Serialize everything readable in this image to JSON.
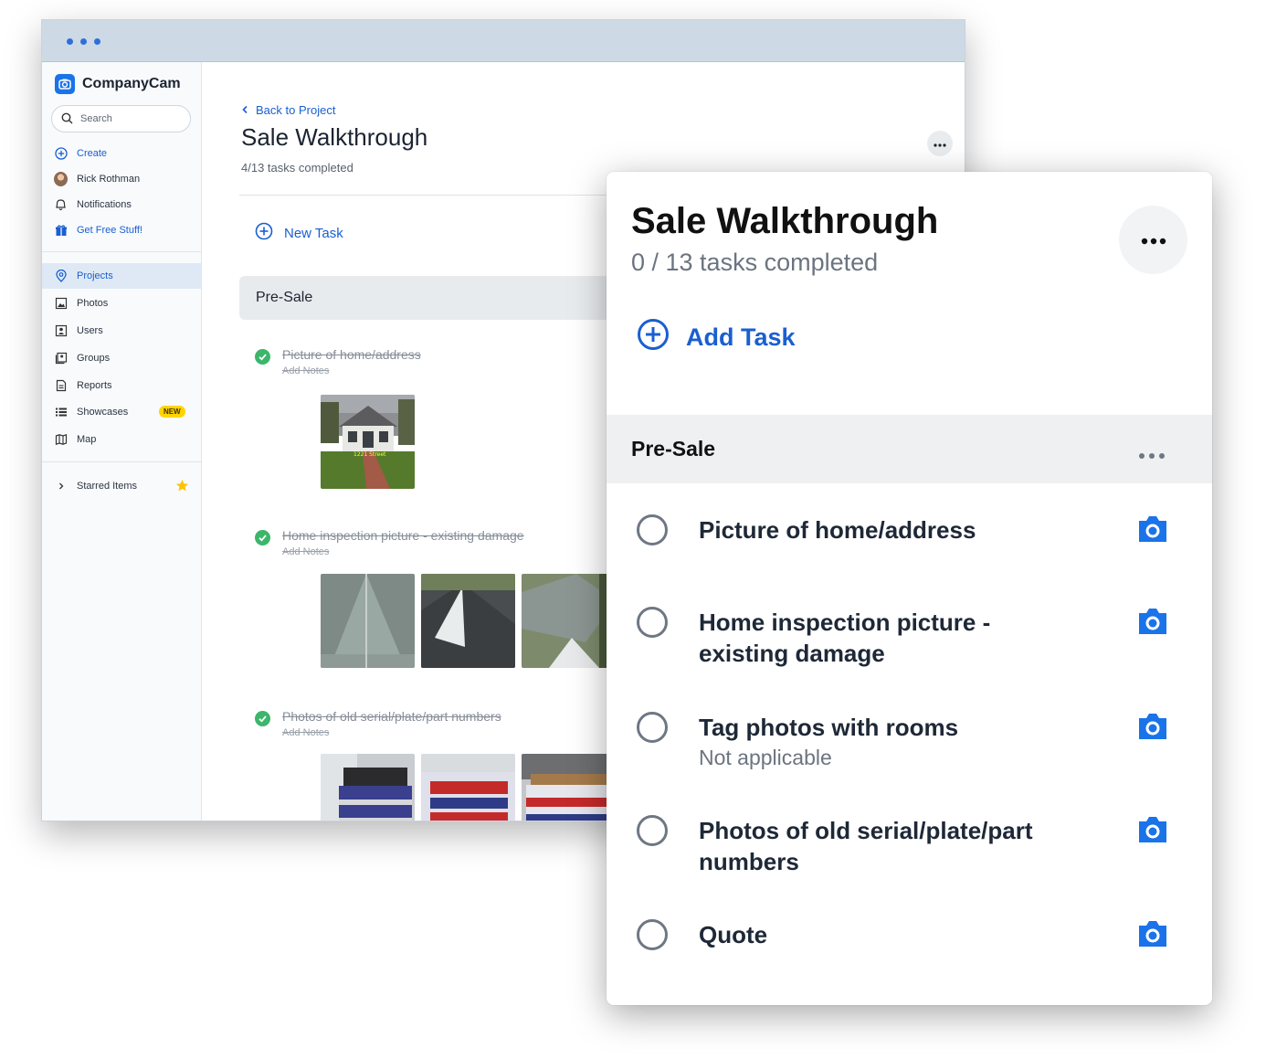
{
  "app": {
    "brand": "CompanyCam",
    "search_placeholder": "Search"
  },
  "sidebar": {
    "top_items": [
      {
        "label": "Create",
        "icon": "plus-circle-icon"
      },
      {
        "label": "Rick Rothman",
        "icon": "avatar"
      },
      {
        "label": "Notifications",
        "icon": "bell-icon"
      },
      {
        "label": "Get Free Stuff!",
        "icon": "gift-icon"
      }
    ],
    "nav_items": [
      {
        "label": "Projects",
        "icon": "location-pin-icon",
        "active": true
      },
      {
        "label": "Photos",
        "icon": "photos-icon"
      },
      {
        "label": "Users",
        "icon": "user-icon"
      },
      {
        "label": "Groups",
        "icon": "groups-icon"
      },
      {
        "label": "Reports",
        "icon": "report-icon"
      },
      {
        "label": "Showcases",
        "icon": "list-icon",
        "badge": "NEW"
      },
      {
        "label": "Map",
        "icon": "map-icon"
      }
    ],
    "starred": {
      "label": "Starred Items",
      "icon": "star-icon"
    }
  },
  "desktop": {
    "back_label": "Back to Project",
    "title": "Sale Walkthrough",
    "tasks_completed": "4/13 tasks completed",
    "new_task_label": "New Task",
    "section_title": "Pre-Sale",
    "tasks": [
      {
        "name": "Picture of home/address",
        "notes": "Add Notes",
        "photo_count": 1
      },
      {
        "name": "Home inspection picture - existing damage",
        "notes": "Add Notes",
        "photo_count": 4
      },
      {
        "name": "Photos of old serial/plate/part numbers",
        "notes": "Add Notes",
        "photo_count": 3
      }
    ],
    "photo_captions": {
      "house_caption": "1221 Street"
    }
  },
  "mobile": {
    "title": "Sale Walkthrough",
    "tasks_completed": "0 / 13 tasks completed",
    "add_task_label": "Add Task",
    "section_title": "Pre-Sale",
    "tasks": [
      {
        "label": "Picture of home/address",
        "sub": ""
      },
      {
        "label": "Home inspection picture - existing damage",
        "sub": ""
      },
      {
        "label": "Tag photos with rooms",
        "sub": "Not applicable"
      },
      {
        "label": "Photos of old serial/plate/part numbers",
        "sub": ""
      },
      {
        "label": "Quote",
        "sub": ""
      }
    ]
  },
  "colors": {
    "accent": "#1a5fd0",
    "check": "#3bb66a",
    "badge": "#ffd400",
    "titlebar": "#cdd9e5"
  }
}
